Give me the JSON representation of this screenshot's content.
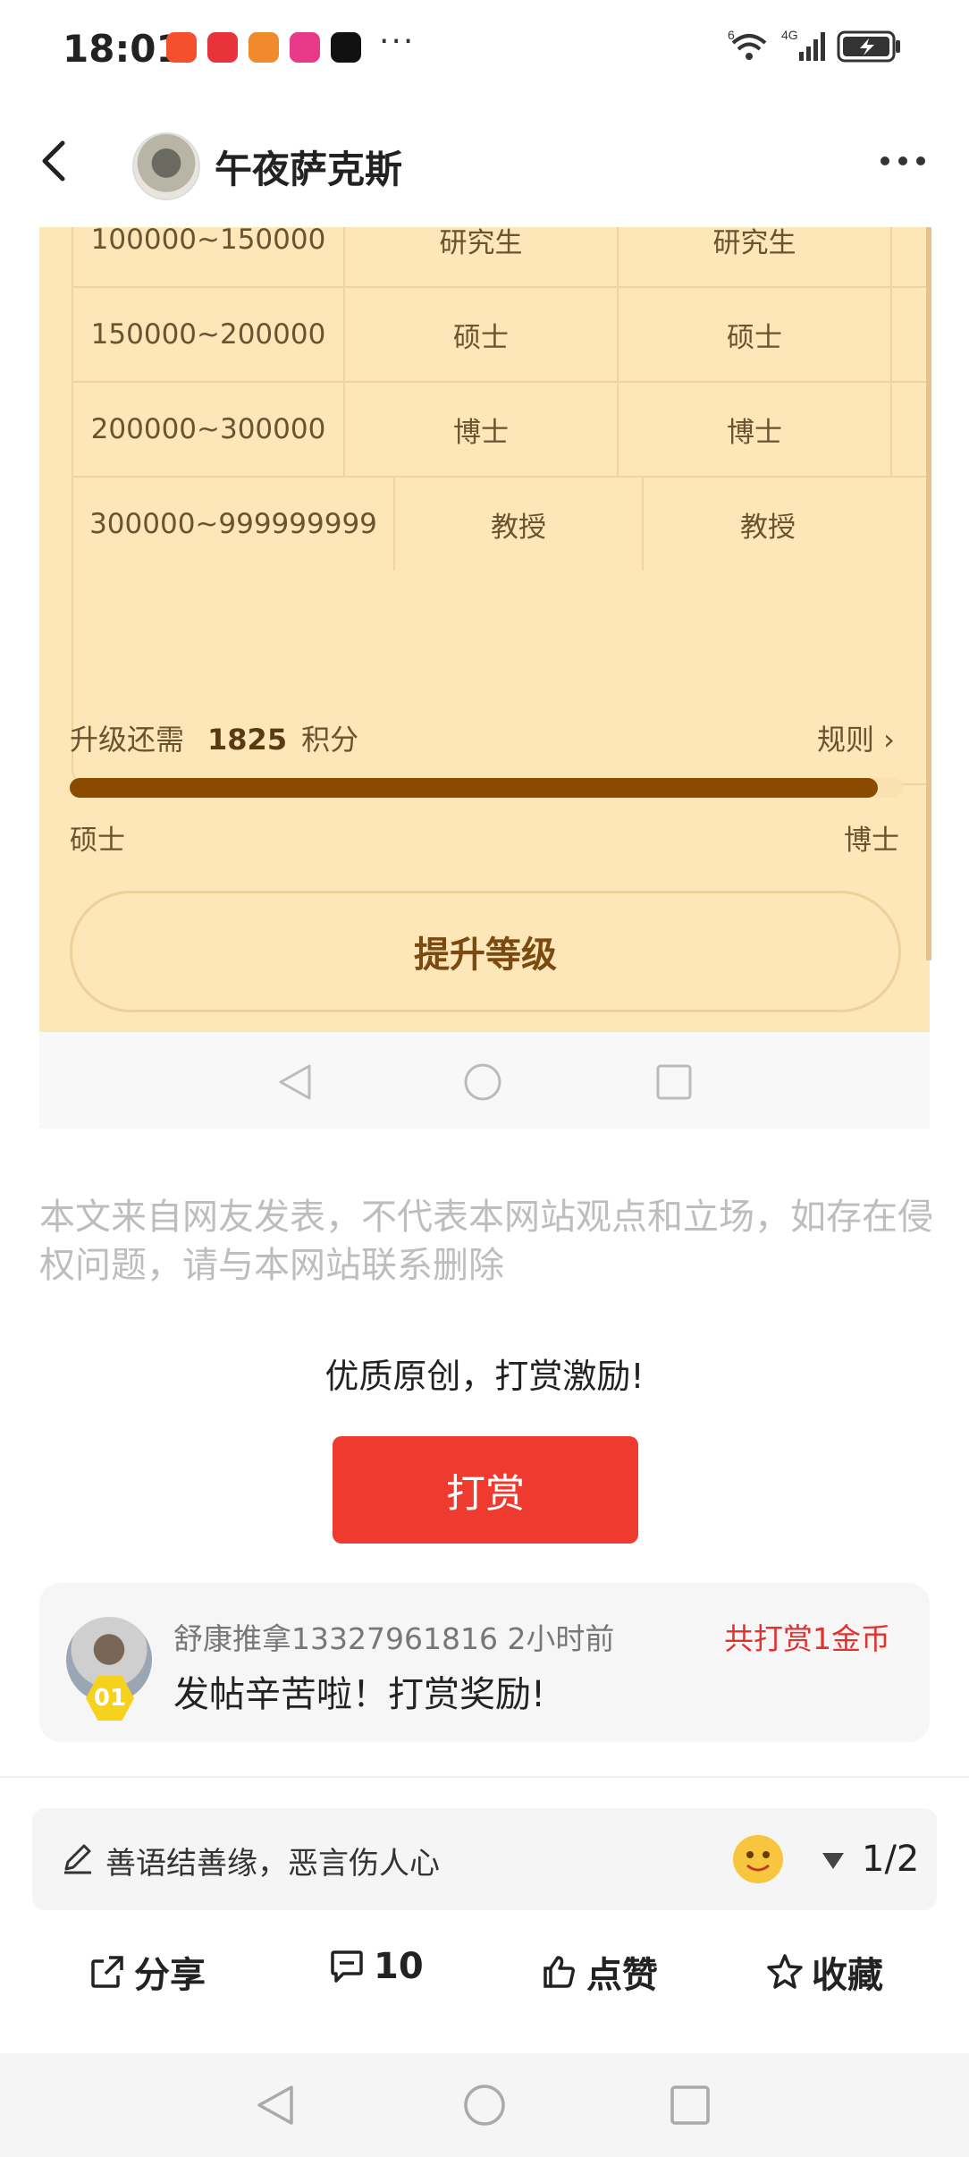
{
  "status_bar": {
    "time": "18:01",
    "more": "···",
    "signal_label": "6",
    "network": "4G"
  },
  "header": {
    "forum_name": "午夜萨克斯"
  },
  "level_table": {
    "partial_row": [
      "100000~150000",
      "研究生",
      "研究生"
    ],
    "rows": [
      [
        "150000~200000",
        "硕士",
        "硕士"
      ],
      [
        "200000~300000",
        "博士",
        "博士"
      ],
      [
        "300000~999999999",
        "教授",
        "教授"
      ]
    ]
  },
  "upgrade": {
    "prefix": "升级还需",
    "points": "1825",
    "suffix": "积分",
    "rules_label": "规则 ›",
    "progress_fraction": 0.97,
    "current_level": "硕士",
    "next_level": "博士",
    "button_label": "提升等级"
  },
  "disclaimer": "本文来自网友发表，不代表本网站观点和立场，如存在侵权问题，请与本网站联系删除",
  "reward": {
    "title": "优质原创，打赏激励!",
    "button_label": "打赏",
    "rank_badge": "01",
    "user_line": "舒康推拿13327961816 2小时前",
    "total": "共打赏1金币",
    "message": "发帖辛苦啦！打赏奖励!"
  },
  "comment_bar": {
    "placeholder": "善语结善缘，恶言伤人心",
    "page_indicator": "1/2"
  },
  "actions": {
    "share": "分享",
    "comments": "10",
    "like": "点赞",
    "favorite": "收藏"
  },
  "colors": {
    "embed_bg": "#fde6b8",
    "progress": "#8a4a00",
    "reward_red": "#ef3b2f",
    "total_red": "#e2322c"
  }
}
